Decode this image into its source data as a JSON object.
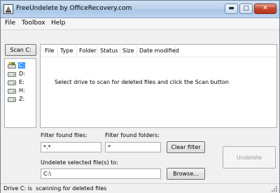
{
  "window": {
    "title": "FreeUndelete by OfficeRecovery.com",
    "icon": "app-icon"
  },
  "menu": [
    "File",
    "Toolbox",
    "Help"
  ],
  "toolbar": {
    "scan_label": "Scan C:"
  },
  "drives": [
    {
      "label": "C:",
      "icon": "system-drive-icon",
      "selected": true
    },
    {
      "label": "D:",
      "icon": "drive-icon",
      "selected": false
    },
    {
      "label": "E:",
      "icon": "drive-icon",
      "selected": false
    },
    {
      "label": "H:",
      "icon": "drive-icon",
      "selected": false
    },
    {
      "label": "Z:",
      "icon": "drive-icon",
      "selected": false
    }
  ],
  "list": {
    "columns": [
      "File",
      "Type",
      "Folder",
      "Status",
      "Size",
      "Date modified"
    ],
    "empty_message": "Select drive to scan for deleted files and click the Scan button"
  },
  "filters": {
    "files_label": "Filter found files:",
    "files_value": "*.*",
    "folders_label": "Filter found folders:",
    "folders_value": "*",
    "clear_label": "Clear filter"
  },
  "undelete": {
    "dest_label": "Undelete selected file(s) to:",
    "dest_value": "C:\\",
    "browse_label": "Browse...",
    "undelete_label": "Undelete"
  },
  "status": {
    "text": "Drive C: is  scanning for deleted files"
  },
  "colors": {
    "title_bar": "#b9d1ea",
    "selection": "#3399ff",
    "close_button": "#c7452a"
  }
}
